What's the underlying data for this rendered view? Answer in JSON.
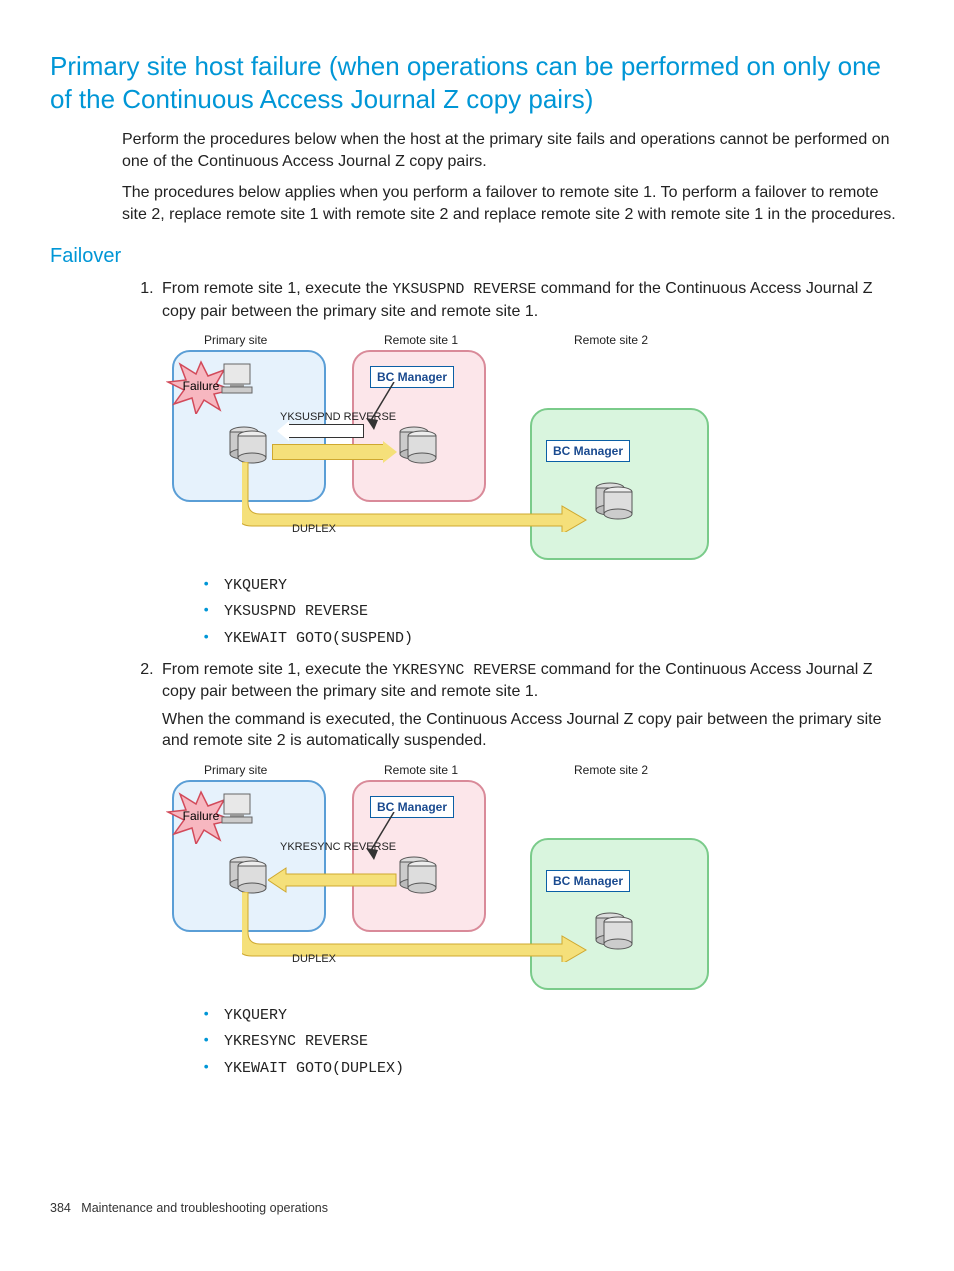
{
  "title": "Primary site host failure (when operations can be performed on only one of the Continuous Access Journal Z copy pairs)",
  "intro": {
    "p1": "Perform the procedures below when the host at the primary site fails and operations cannot be performed on one of the Continuous Access Journal Z copy pairs.",
    "p2": "The procedures below applies when you perform a failover to remote site 1. To perform a failover to remote site 2, replace remote site 1 with remote site 2 and replace remote site 2 with remote site 1 in the procedures."
  },
  "section2": "Failover",
  "steps": {
    "s1": {
      "pre": "From remote site 1, execute the ",
      "cmd": "YKSUSPND REVERSE",
      "post": " command for the Continuous Access Journal Z copy pair between the primary site and remote site 1.",
      "bullets": [
        "YKQUERY",
        "YKSUSPND REVERSE",
        "YKEWAIT GOTO(SUSPEND)"
      ]
    },
    "s2": {
      "pre": "From remote site 1, execute the ",
      "cmd": "YKRESYNC REVERSE",
      "post": " command for the Continuous Access Journal Z copy pair between the primary site and remote site 1.",
      "extra": "When the command is executed, the Continuous Access Journal Z copy pair between the primary site and remote site 2 is automatically suspended.",
      "bullets": [
        "YKQUERY",
        "YKRESYNC REVERSE",
        "YKEWAIT GOTO(DUPLEX)"
      ]
    }
  },
  "diagram": {
    "primary": "Primary site",
    "remote1": "Remote site 1",
    "remote2": "Remote site 2",
    "bc": "BC Manager",
    "failure": "Failure",
    "duplex": "DUPLEX",
    "cmd1": "YKSUSPND REVERSE",
    "cmd2": "YKRESYNC REVERSE"
  },
  "footer": {
    "page": "384",
    "chapter": "Maintenance and troubleshooting operations"
  }
}
